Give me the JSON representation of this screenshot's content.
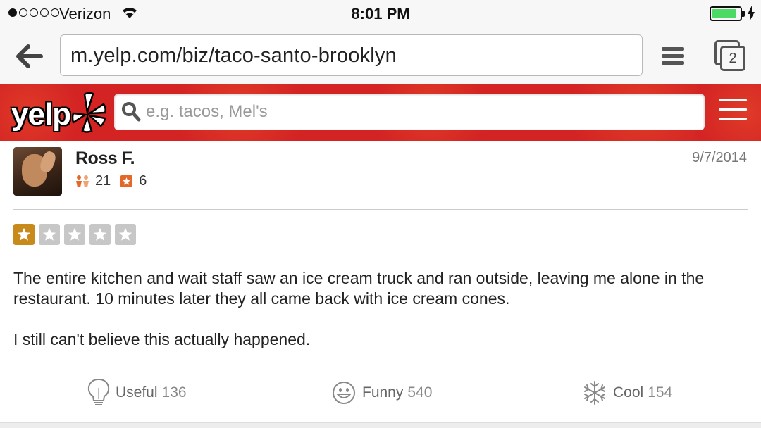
{
  "status_bar": {
    "signal_dots_filled": 1,
    "signal_dots_total": 5,
    "carrier": "Verizon",
    "time": "8:01 PM",
    "battery_level": 0.9,
    "battery_color": "#4cd964"
  },
  "browser": {
    "url": "m.yelp.com/biz/taco-santo-brooklyn",
    "tab_count": "2"
  },
  "yelp_header": {
    "logo_text": "yelp",
    "brand_color": "#d32323",
    "search_placeholder": "e.g. tacos, Mel's"
  },
  "review": {
    "user_name": "Ross F.",
    "friends_count": "21",
    "reviews_count": "6",
    "date": "9/7/2014",
    "rating": 1,
    "rating_max": 5,
    "star_on_color": "#c98a1c",
    "star_off_color": "#c7c7c7",
    "paragraphs": [
      "The entire kitchen and wait staff saw an ice cream truck and ran outside, leaving me alone in the restaurant. 10 minutes later they all came back with ice cream cones.",
      "I still can't believe this actually happened."
    ]
  },
  "votes": {
    "useful_label": "Useful",
    "useful_count": "136",
    "funny_label": "Funny",
    "funny_count": "540",
    "cool_label": "Cool",
    "cool_count": "154"
  }
}
